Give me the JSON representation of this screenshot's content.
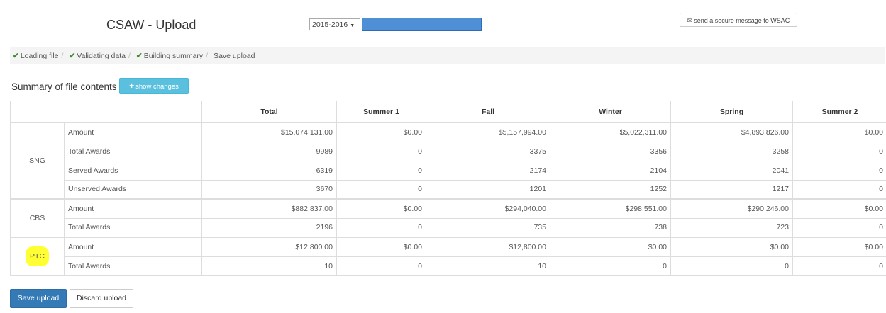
{
  "header": {
    "title": "CSAW - Upload",
    "year_select": "2015-2016",
    "message_button": "send a secure message to WSAC",
    "redacted_color": "#4f8fd6"
  },
  "breadcrumb": [
    {
      "label": "Loading file",
      "done": true
    },
    {
      "label": "Validating data",
      "done": true
    },
    {
      "label": "Building summary",
      "done": true
    },
    {
      "label": "Save upload",
      "done": false
    }
  ],
  "summary": {
    "title": "Summary of file contents",
    "show_changes_label": "show changes"
  },
  "table": {
    "columns": [
      "",
      "",
      "Total",
      "Summer 1",
      "Fall",
      "Winter",
      "Spring",
      "Summer 2"
    ],
    "groups": [
      {
        "name": "SNG",
        "highlighted": false,
        "rows": [
          {
            "label": "Amount",
            "values": [
              "$15,074,131.00",
              "$0.00",
              "$5,157,994.00",
              "$5,022,311.00",
              "$4,893,826.00",
              "$0.00"
            ]
          },
          {
            "label": "Total Awards",
            "values": [
              "9989",
              "0",
              "3375",
              "3356",
              "3258",
              "0"
            ]
          },
          {
            "label": "Served Awards",
            "values": [
              "6319",
              "0",
              "2174",
              "2104",
              "2041",
              "0"
            ]
          },
          {
            "label": "Unserved Awards",
            "values": [
              "3670",
              "0",
              "1201",
              "1252",
              "1217",
              "0"
            ]
          }
        ]
      },
      {
        "name": "CBS",
        "highlighted": false,
        "rows": [
          {
            "label": "Amount",
            "values": [
              "$882,837.00",
              "$0.00",
              "$294,040.00",
              "$298,551.00",
              "$290,246.00",
              "$0.00"
            ]
          },
          {
            "label": "Total Awards",
            "values": [
              "2196",
              "0",
              "735",
              "738",
              "723",
              "0"
            ]
          }
        ]
      },
      {
        "name": "PTC",
        "highlighted": true,
        "rows": [
          {
            "label": "Amount",
            "values": [
              "$12,800.00",
              "$0.00",
              "$12,800.00",
              "$0.00",
              "$0.00",
              "$0.00"
            ]
          },
          {
            "label": "Total Awards",
            "values": [
              "10",
              "0",
              "10",
              "0",
              "0",
              "0"
            ]
          }
        ]
      }
    ]
  },
  "actions": {
    "save_label": "Save upload",
    "discard_label": "Discard upload"
  },
  "colors": {
    "primary": "#337ab7",
    "info": "#5bc0de",
    "check": "#3c8a2e",
    "highlight": "#ffff33"
  }
}
